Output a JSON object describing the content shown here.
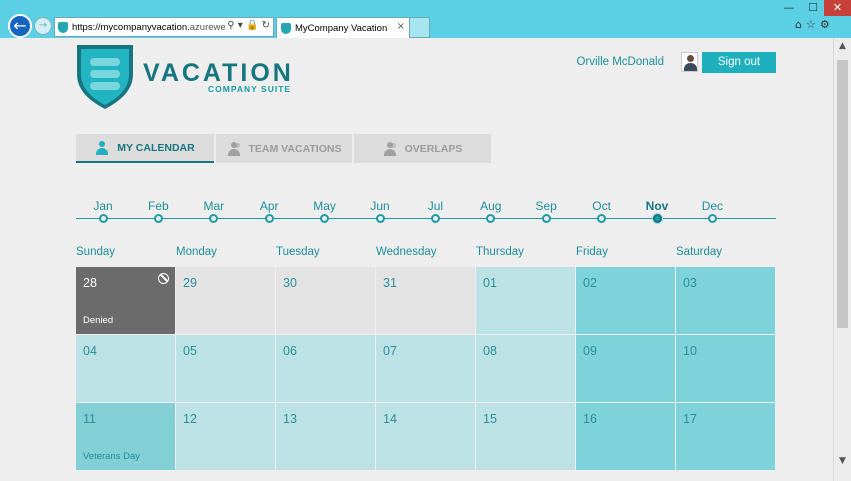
{
  "browser": {
    "url_domain": "https://mycompanyvacation.",
    "url_rest": "azurewebsit...",
    "addr_icons": "⚲ ▾ 🔒 ↻",
    "tab_title": "MyCompany Vacation",
    "tab_close": "×",
    "back": "←",
    "forward": "→",
    "win_min": "—",
    "win_max": "☐",
    "win_close": "✕",
    "tools": "⌂☆⚙"
  },
  "logo": {
    "title": "VACATION",
    "subtitle": "COMPANY SUITE",
    "colors": {
      "shield_dark": "#16767f",
      "shield_light": "#22b4c0"
    }
  },
  "user": {
    "name": "Orville McDonald",
    "sign_out": "Sign out"
  },
  "tabs": [
    {
      "label": "MY CALENDAR",
      "active": true,
      "icon": "person-icon"
    },
    {
      "label": "TEAM VACATIONS",
      "active": false,
      "icon": "people-icon"
    },
    {
      "label": "OVERLAPS",
      "active": false,
      "icon": "people-icon"
    }
  ],
  "timeline": {
    "months": [
      "Jan",
      "Feb",
      "Mar",
      "Apr",
      "May",
      "Jun",
      "Jul",
      "Aug",
      "Sep",
      "Oct",
      "Nov",
      "Dec"
    ],
    "current": "Nov"
  },
  "weekdays": [
    "Sunday",
    "Monday",
    "Tuesday",
    "Wednesday",
    "Thursday",
    "Friday",
    "Saturday"
  ],
  "calendar": [
    [
      {
        "day": "28",
        "status": "denied",
        "label": "Denied"
      },
      {
        "day": "29",
        "status": "past",
        "label": ""
      },
      {
        "day": "30",
        "status": "past",
        "label": ""
      },
      {
        "day": "31",
        "status": "past",
        "label": ""
      },
      {
        "day": "01",
        "status": "light",
        "label": ""
      },
      {
        "day": "02",
        "status": "dark",
        "label": ""
      },
      {
        "day": "03",
        "status": "dark",
        "label": ""
      }
    ],
    [
      {
        "day": "04",
        "status": "light",
        "label": ""
      },
      {
        "day": "05",
        "status": "light",
        "label": ""
      },
      {
        "day": "06",
        "status": "light",
        "label": ""
      },
      {
        "day": "07",
        "status": "light",
        "label": ""
      },
      {
        "day": "08",
        "status": "light",
        "label": ""
      },
      {
        "day": "09",
        "status": "dark",
        "label": ""
      },
      {
        "day": "10",
        "status": "dark",
        "label": ""
      }
    ],
    [
      {
        "day": "11",
        "status": "holiday",
        "label": "Veterans Day"
      },
      {
        "day": "12",
        "status": "light",
        "label": ""
      },
      {
        "day": "13",
        "status": "light",
        "label": ""
      },
      {
        "day": "14",
        "status": "light",
        "label": ""
      },
      {
        "day": "15",
        "status": "light",
        "label": ""
      },
      {
        "day": "16",
        "status": "dark",
        "label": ""
      },
      {
        "day": "17",
        "status": "dark",
        "label": ""
      }
    ]
  ],
  "scroll": {
    "up": "▲",
    "down": "▼"
  }
}
